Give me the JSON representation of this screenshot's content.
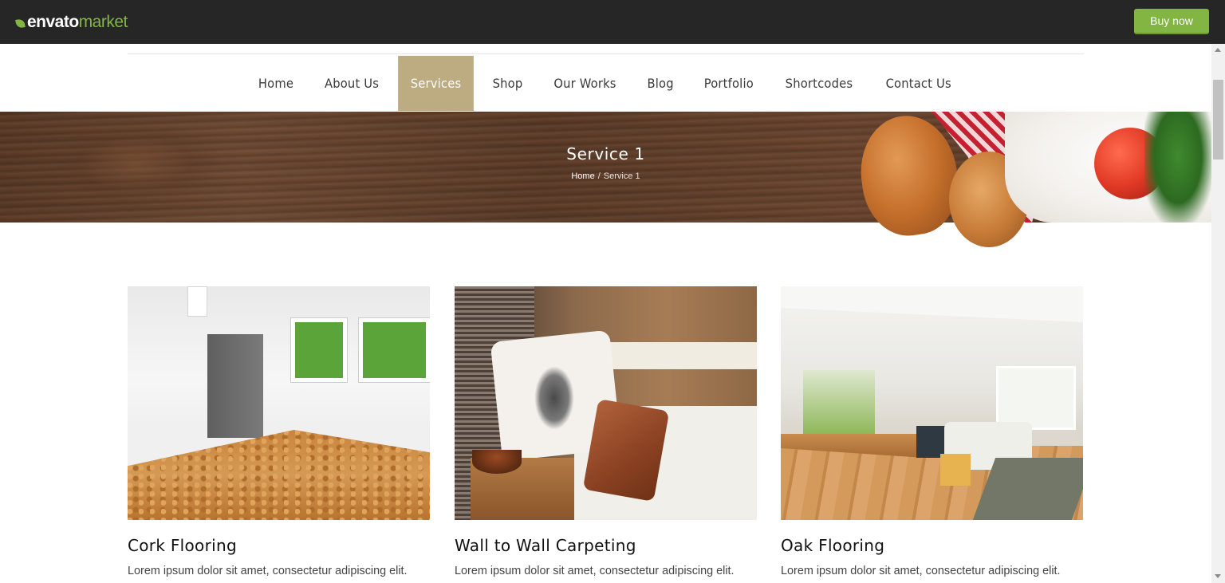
{
  "topbar": {
    "logo_word1": "envato",
    "logo_word2": "market",
    "buy_button": "Buy now",
    "colors": {
      "bar": "#262626",
      "accent": "#82b541"
    }
  },
  "nav": {
    "items": [
      {
        "label": "Home"
      },
      {
        "label": "About Us"
      },
      {
        "label": "Services",
        "active": true
      },
      {
        "label": "Shop"
      },
      {
        "label": "Our Works"
      },
      {
        "label": "Blog"
      },
      {
        "label": "Portfolio"
      },
      {
        "label": "Shortcodes"
      },
      {
        "label": "Contact Us"
      }
    ],
    "active_color": "#bdac82"
  },
  "hero": {
    "title": "Service 1",
    "breadcrumb": {
      "home": "Home",
      "separator": "/",
      "current": "Service 1"
    }
  },
  "services": [
    {
      "title": "Cork Flooring",
      "text": "Lorem ipsum dolor sit amet, consectetur adipiscing elit."
    },
    {
      "title": "Wall to Wall Carpeting",
      "text": "Lorem ipsum dolor sit amet, consectetur adipiscing elit."
    },
    {
      "title": "Oak Flooring",
      "text": "Lorem ipsum dolor sit amet, consectetur adipiscing elit."
    }
  ]
}
